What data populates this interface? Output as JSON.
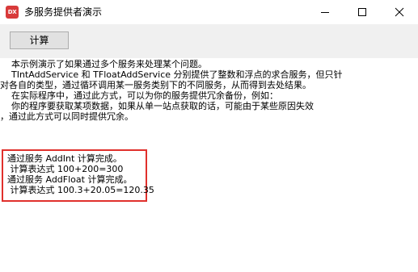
{
  "window": {
    "icon_text": "DX",
    "title": "多服务提供者演示"
  },
  "toolbar": {
    "calc_label": "计算"
  },
  "memo": {
    "description": [
      "    本示例演示了如果通过多个服务来处理某个问题。",
      "    TIntAddService 和 TFloatAddService 分别提供了整数和浮点的求合服务，但只针",
      "对各自的类型，通过循环调用某一服务类别下的不同服务，从而得到去处结果。",
      "    在实际程序中，通过此方式，可以为你的服务提供冗余备份，例如：",
      "    你的程序要获取某项数据，如果从单一站点获取的话，可能由于某些原因失效",
      "，通过此方式可以同时提供冗余。"
    ],
    "results": [
      "通过服务 AddInt 计算完成。",
      " 计算表达式 100+200=300",
      "通过服务 AddFloat 计算完成。",
      " 计算表达式 100.3+20.05=120.35"
    ],
    "highlight_color": "#e0302c"
  }
}
